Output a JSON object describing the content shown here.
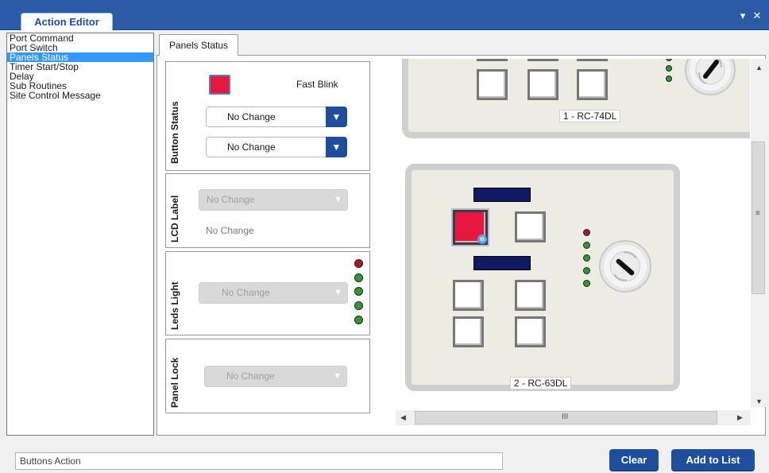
{
  "window": {
    "title": "Action Editor",
    "menu_icon": "▾",
    "close_icon": "✕"
  },
  "actions": [
    "Port Command",
    "Port Switch",
    "Panels Status",
    "Timer Start/Stop",
    "Delay",
    "Sub Routines",
    "Site Control Message"
  ],
  "selected_action": "Panels Status",
  "tab": {
    "label": "Panels Status"
  },
  "button_status": {
    "label": "Button Status",
    "mode": "Fast Blink",
    "select1": "No Change",
    "select2": "No Change",
    "color": "#e8173f"
  },
  "lcd_label": {
    "label": "LCD Label",
    "select": "No Change",
    "text": "No Change"
  },
  "leds_light": {
    "label": "Leds Light",
    "select": "No Change",
    "leds": [
      "red",
      "green",
      "green",
      "green",
      "green"
    ]
  },
  "panel_lock": {
    "label": "Panel Lock",
    "select": "No Change"
  },
  "panels": [
    {
      "name": "1 - RC-74DL"
    },
    {
      "name": "2 - RC-63DL"
    }
  ],
  "hscroll_grip": "III",
  "vscroll_grip": "≡",
  "footer": {
    "buttons_action": "Buttons Action",
    "clear": "Clear",
    "add_to_list": "Add to List"
  },
  "colors": {
    "accent": "#1f4f9c",
    "title_bar": "#2b5aa6",
    "selected_red": "#e8173f",
    "selection": "#3399ff"
  }
}
